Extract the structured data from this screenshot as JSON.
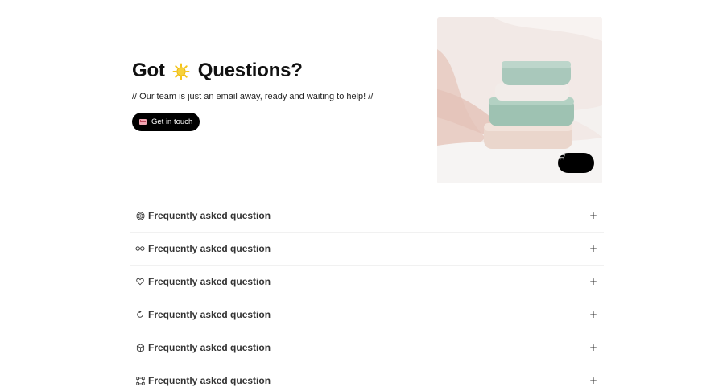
{
  "hero": {
    "title_before": "Got",
    "title_emoji_icon": "sun-icon",
    "title_after": "Questions?",
    "subtitle": "// Our team is just an email away, ready and waiting to help! //",
    "cta_label": "Get in touch",
    "cta_icon": "love-letter-icon"
  },
  "photo": {
    "subject": "folded towels on bed",
    "cart_icon": "shopping-cart-icon"
  },
  "faq": {
    "items": [
      {
        "icon": "target-icon",
        "label": "Frequently asked question",
        "toggle": "+"
      },
      {
        "icon": "infinity-icon",
        "label": "Frequently asked question",
        "toggle": "+"
      },
      {
        "icon": "heart-icon",
        "label": "Frequently asked question",
        "toggle": "+"
      },
      {
        "icon": "refresh-icon",
        "label": "Frequently asked question",
        "toggle": "+"
      },
      {
        "icon": "cube-icon",
        "label": "Frequently asked question",
        "toggle": "+"
      },
      {
        "icon": "nodes-icon",
        "label": "Frequently asked question",
        "toggle": "+"
      }
    ]
  },
  "colors": {
    "text": "#111111",
    "button_bg": "#000000",
    "button_text": "#ffffff",
    "sun": "#f5c518"
  }
}
